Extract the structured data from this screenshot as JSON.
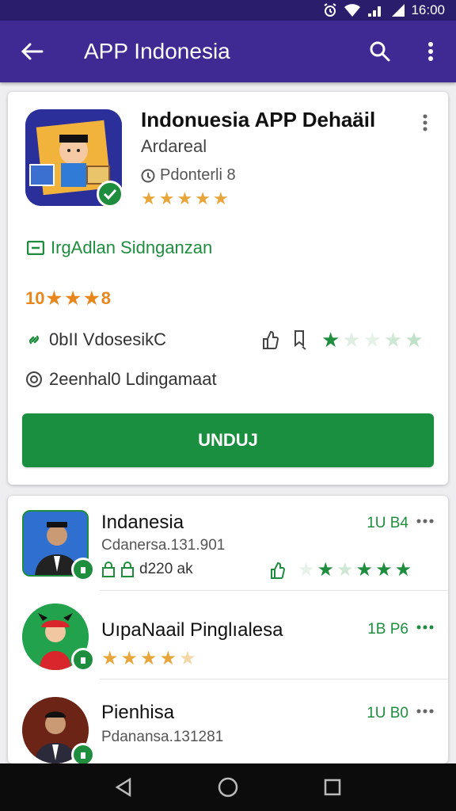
{
  "status_bar": {
    "time": "16:00"
  },
  "app_bar": {
    "title": "APP Indonesia"
  },
  "app": {
    "title": "Indonuesia APP Dehaäil",
    "developer": "Ardareal",
    "downloads": "Pdonterli 8",
    "rating_stars": 5,
    "install_label": "IrgAdlan Sidnganzan",
    "rating_text_left": "10",
    "rating_text_right": "8",
    "dev_link": "0bII VdosesikC",
    "privacy": "2eenhal0 Ldingamaat",
    "install_button": "UNDUJ"
  },
  "colors": {
    "accent": "#3f2a94",
    "status": "#2a1d6b",
    "green": "#1a8f3f",
    "orange": "#e8871e"
  },
  "list": [
    {
      "title": "Indanesia",
      "subtitle": "Cdanersa.131.901",
      "size": "1U B4",
      "meta": "d220 ak",
      "stars": 5,
      "faded_stars": 2
    },
    {
      "title": "UıpaNaail Pinglıalesa",
      "size": "1B P6",
      "stars": 4,
      "faded_stars": 1
    },
    {
      "title": "Pienhisa",
      "subtitle": "Pdanansa.131281",
      "size": "1U B0"
    }
  ]
}
